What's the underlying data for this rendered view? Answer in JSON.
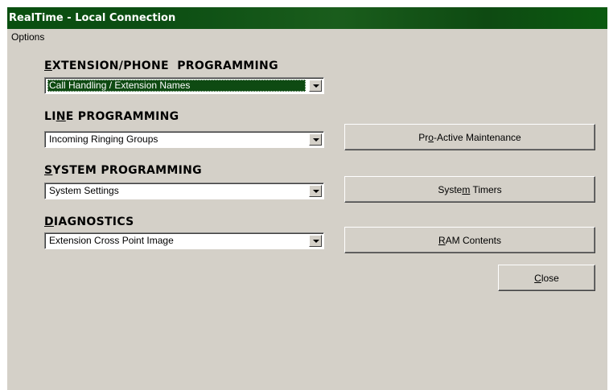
{
  "window": {
    "title": "RealTime - Local Connection"
  },
  "menu": {
    "options": "Options"
  },
  "sections": {
    "extension_phone": {
      "label_first": "E",
      "label_rest": "XTENSION/PHONE  PROGRAMMING",
      "selected": "Call Handling / Extension Names"
    },
    "line": {
      "label_pre": "LI",
      "label_mnemonic": "N",
      "label_post": "E PROGRAMMING",
      "selected": "Incoming Ringing Groups"
    },
    "system": {
      "label_first": "S",
      "label_rest": "YSTEM PROGRAMMING",
      "selected": "System Settings"
    },
    "diagnostics": {
      "label_first": "D",
      "label_rest": "IAGNOSTICS",
      "selected": "Extension Cross Point Image"
    }
  },
  "buttons": {
    "proactive": {
      "pre": "Pr",
      "mnemonic": "o",
      "post": "-Active Maintenance"
    },
    "system_timers": {
      "pre": "Syste",
      "mnemonic": "m",
      "post": " Timers"
    },
    "ram_contents": {
      "pre": "",
      "mnemonic": "R",
      "post": "AM Contents"
    },
    "close": {
      "pre": "",
      "mnemonic": "C",
      "post": "lose"
    }
  },
  "colors": {
    "titlebar": "#0e4a12",
    "dialog_bg": "#d4d0c8",
    "selection": "#0e4a12"
  }
}
